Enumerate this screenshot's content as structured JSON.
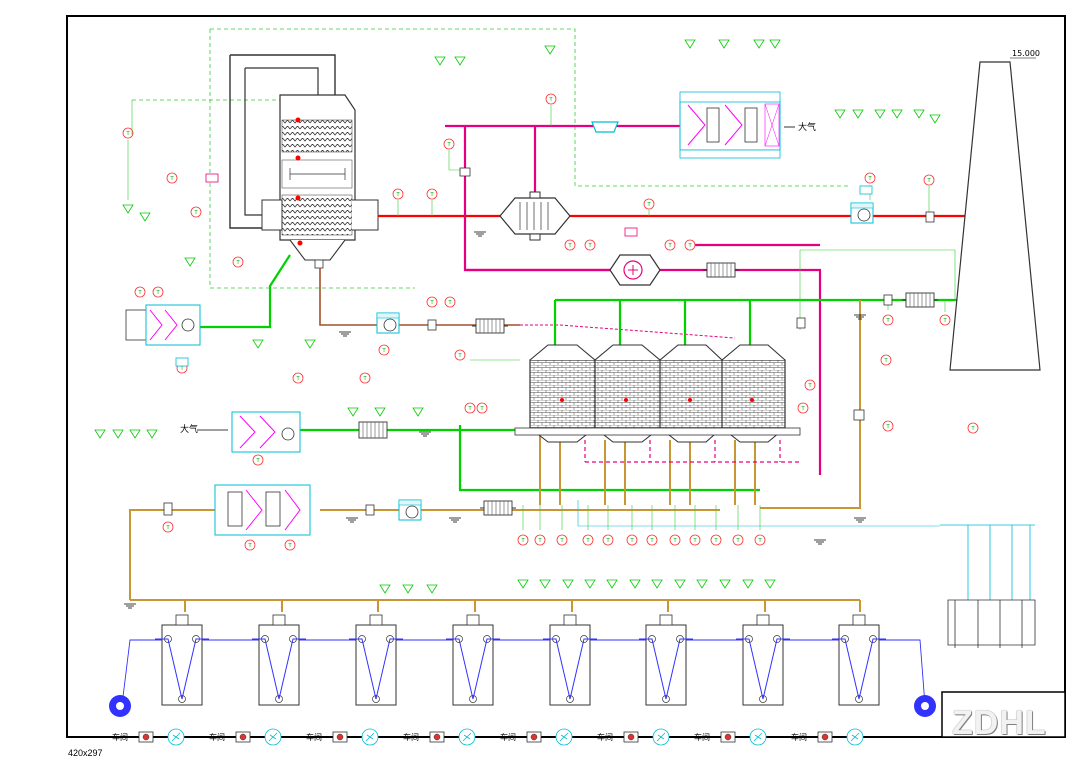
{
  "drawing": {
    "sheet_size": "420x297",
    "elevation_mark": "15.000",
    "atmosphere_label": "大气",
    "workshop_label": "车间",
    "title_block_logo": "ZDHL"
  },
  "colors": {
    "frame": "#000000",
    "flue_gas": "#e6007e",
    "hot_air": "#ff0000",
    "fresh_air": "#00d200",
    "exhaust_main": "#c89632",
    "workshop_loop": "#3232ff",
    "instrument": "#00cc00",
    "equipment": "#00c8c8",
    "outline": "#333333"
  },
  "icons": [
    "fan-icon",
    "heat-exchanger-icon",
    "filter-icon",
    "valve-icon",
    "stack-icon",
    "instrument-bubble-icon",
    "ground-symbol-icon"
  ]
}
